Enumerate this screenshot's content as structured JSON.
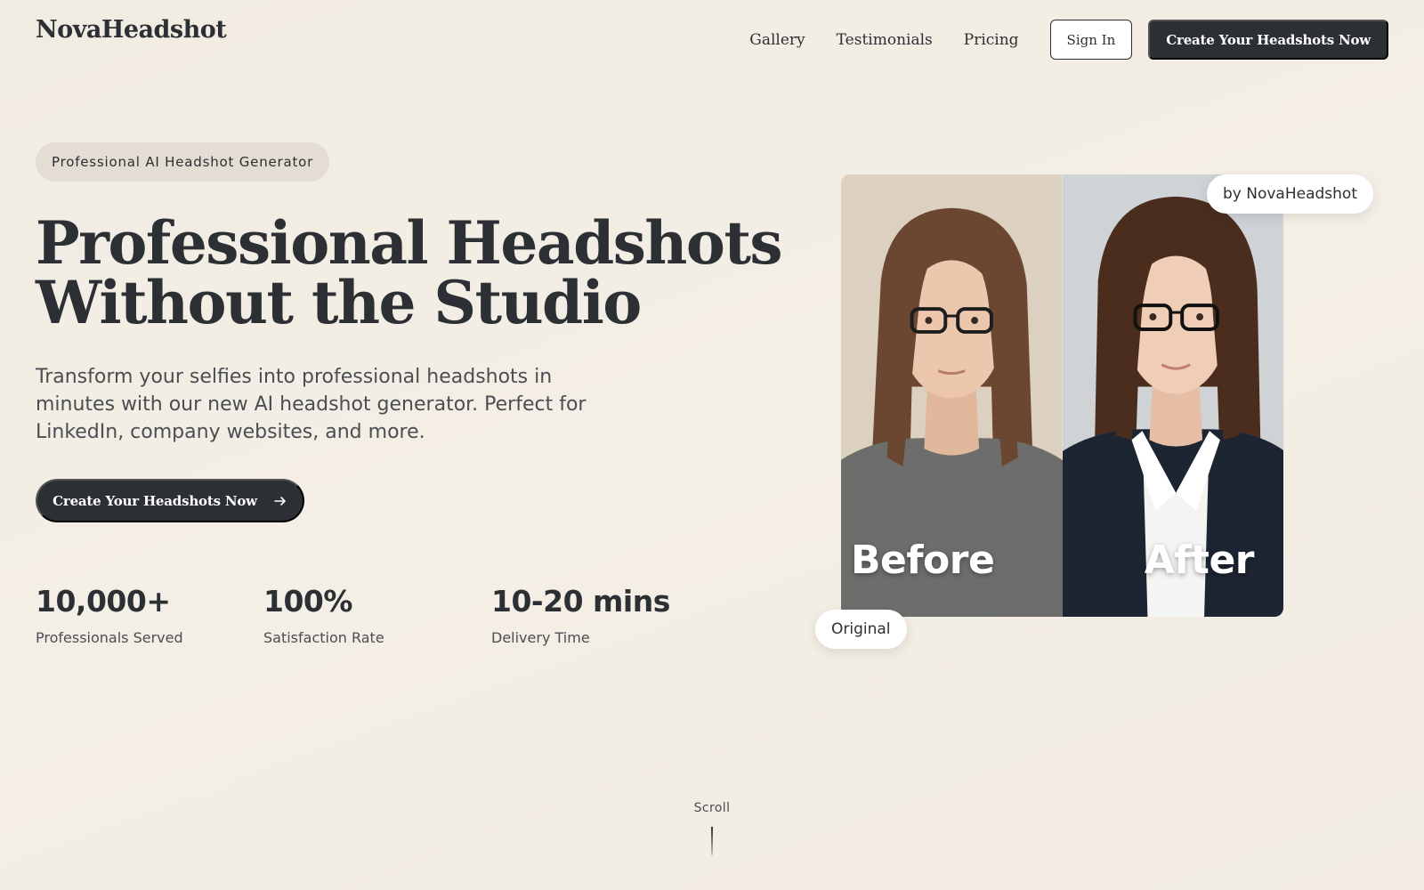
{
  "header": {
    "logo": "NovaHeadshot",
    "nav": [
      "Gallery",
      "Testimonials",
      "Pricing"
    ],
    "sign_in": "Sign In",
    "cta": "Create Your Headshots Now"
  },
  "hero": {
    "pill": "Professional AI Headshot Generator",
    "headline_line1": "Professional Headshots",
    "headline_line2": "Without the Studio",
    "subtext": "Transform your selfies into professional headshots in minutes with our new AI headshot generator. Perfect for LinkedIn, company websites, and more.",
    "cta": "Create Your Headshots Now",
    "cta_icon": "arrow-right-icon"
  },
  "stats": [
    {
      "value": "10,000+",
      "label": "Professionals Served"
    },
    {
      "value": "100%",
      "label": "Satisfaction Rate"
    },
    {
      "value": "10-20 mins",
      "label": "Delivery Time"
    }
  ],
  "showcase": {
    "before_label": "Before",
    "after_label": "After",
    "badge_by": "by NovaHeadshot",
    "badge_original": "Original"
  },
  "scroll": "Scroll",
  "colors": {
    "background": "#f3eee5",
    "primary": "#2c3035",
    "pill": "#e3ddd3",
    "text": "#2c2f33"
  }
}
